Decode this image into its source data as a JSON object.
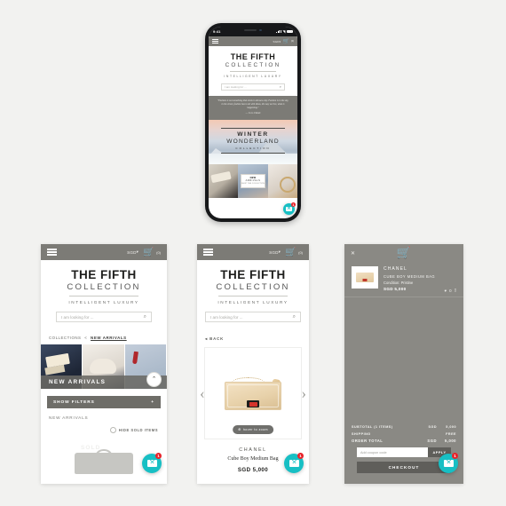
{
  "page": {
    "background": "#f2f2f0"
  },
  "brand": {
    "line1": "THE FIFTH",
    "line2": "COLLECTION",
    "tagline": "INTELLIGENT LUXURY"
  },
  "header": {
    "menu_icon": "hamburger-icon",
    "currency": "SGD",
    "currency_caret": "▾",
    "cart_icon": "shopping-cart-icon",
    "cart_count": "(0)"
  },
  "search": {
    "placeholder": "I am looking for ...",
    "icon": "search-icon"
  },
  "phone": {
    "status": {
      "time": "9:41",
      "wifi_icon": "wifi-icon",
      "signal_icon": "signal-icon",
      "battery_icon": "battery-icon"
    },
    "quote": {
      "text": "\"Fashion is not something that exists in dresses only. Fashion is in the sky, in the street, fashion has to do with ideas, the way we live, what is happening.\"",
      "attribution": "— Coco Chanel"
    },
    "hero": {
      "line1": "WINTER",
      "line2": "WONDERLAND",
      "line3": "COLLECTION"
    },
    "tile_badge": {
      "line1": "NEW",
      "line2": "ARRIVALS",
      "line3": "SHOP THE COLLECTION"
    }
  },
  "listing": {
    "breadcrumb": {
      "parent": "COLLECTIONS",
      "separator": "<",
      "current": "NEW ARRIVALS"
    },
    "strip_label": "NEW ARRIVALS",
    "scroll_up_icon": "chevron-up-icon",
    "filters_label": "SHOW FILTERS",
    "filters_plus": "+",
    "section_title": "NEW ARRIVALS",
    "hide_sold_label": "HIDE SOLD ITEMS",
    "product_tag": "SOLD"
  },
  "product": {
    "back_label": "BACK",
    "back_icon": "arrow-left-icon",
    "prev_arrow": "‹",
    "next_arrow": "›",
    "zoom_hint": "hover to zoom",
    "zoom_icon": "magnifier-icon",
    "brand": "CHANEL",
    "name": "Cube Boy Medium Bag",
    "price": "SGD 5,000"
  },
  "cart": {
    "close_icon": "close-icon",
    "cart_icon": "shopping-cart-icon",
    "item": {
      "brand": "CHANEL",
      "name": "CUBE BOY MEDIUM BAG",
      "condition": "Condition: Pristine",
      "price": "SGD 5,000",
      "wishlist_icon": "heart-icon",
      "wishlist_count": "0",
      "delete_icon": "trash-icon"
    },
    "summary": [
      {
        "label": "SUBTOTAL (1 ITEMS)",
        "currency": "SGD",
        "amount": "5,000"
      },
      {
        "label": "SHIPPING",
        "currency": "",
        "amount": "FREE"
      },
      {
        "label": "ORDER TOTAL",
        "currency": "SGD",
        "amount": "5,000"
      }
    ],
    "coupon_placeholder": "Add coupon code",
    "apply_label": "APPLY",
    "checkout_label": "CHECKOUT"
  },
  "chat": {
    "icon": "chat-envelope-icon",
    "badge": "1",
    "color": "#17bfc4",
    "badge_color": "#e8232a"
  }
}
